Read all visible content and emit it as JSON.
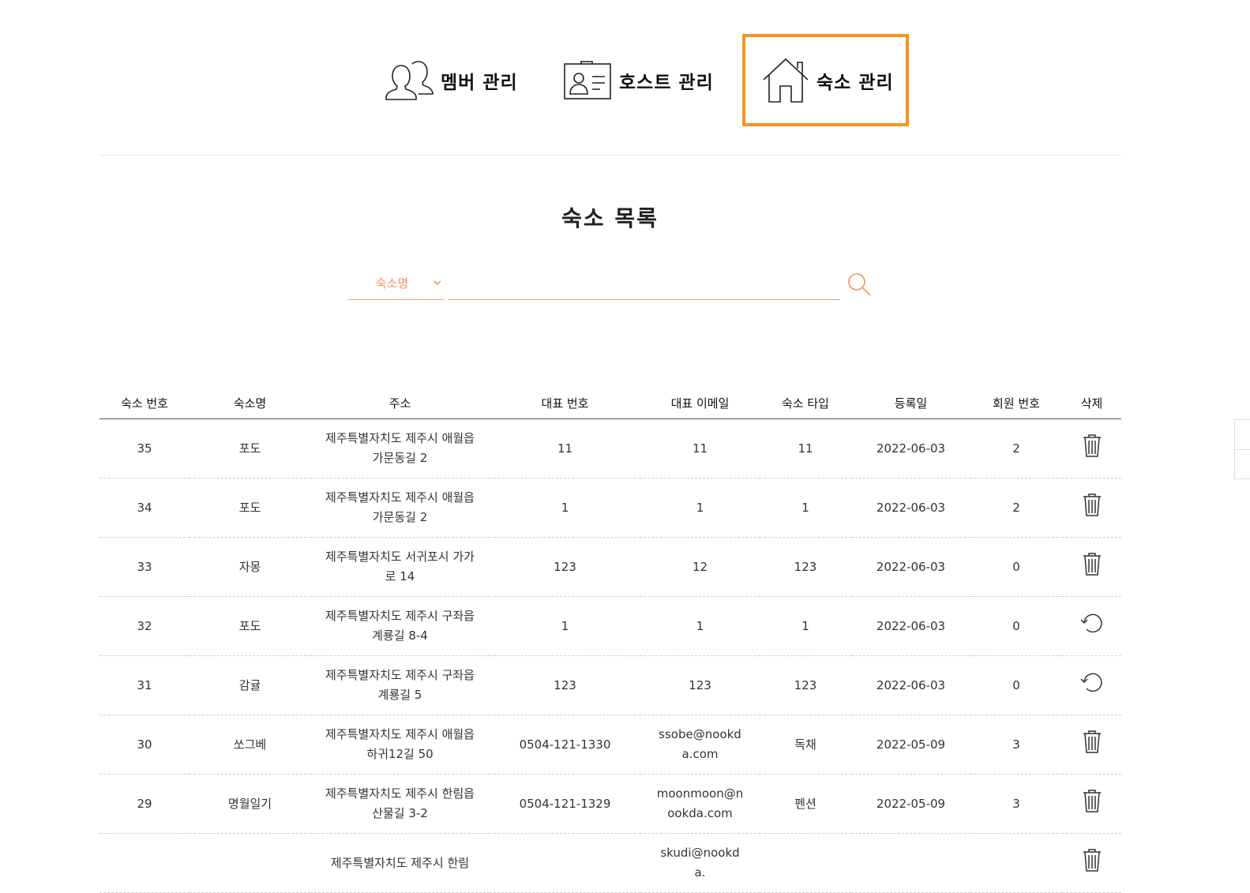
{
  "tabs": [
    {
      "label": "멤버 관리",
      "icon": "users-icon",
      "active": false
    },
    {
      "label": "호스트 관리",
      "icon": "id-card-icon",
      "active": false
    },
    {
      "label": "숙소 관리",
      "icon": "house-icon",
      "active": true
    }
  ],
  "accent_color": "#f7931e",
  "page_title": "숙소 목록",
  "search": {
    "select_value": "숙소명",
    "input_value": "",
    "button_icon": "search-icon"
  },
  "table": {
    "headers": [
      "숙소 번호",
      "숙소명",
      "주소",
      "대표 번호",
      "대표 이메일",
      "숙소 타입",
      "등록일",
      "회원 번호",
      "삭제"
    ],
    "rows": [
      {
        "no": "35",
        "name": "포도",
        "address": "제주특별자치도 제주시 애월읍 가문동길 2",
        "phone": "11",
        "email": "11",
        "type": "11",
        "date": "2022-06-03",
        "member": "2",
        "action": "trash-icon"
      },
      {
        "no": "34",
        "name": "포도",
        "address": "제주특별자치도 제주시 애월읍 가문동길 2",
        "phone": "1",
        "email": "1",
        "type": "1",
        "date": "2022-06-03",
        "member": "2",
        "action": "trash-icon"
      },
      {
        "no": "33",
        "name": "자몽",
        "address": "제주특별자치도 서귀포시 가가로 14",
        "phone": "123",
        "email": "12",
        "type": "123",
        "date": "2022-06-03",
        "member": "0",
        "action": "trash-icon"
      },
      {
        "no": "32",
        "name": "포도",
        "address": "제주특별자치도 제주시 구좌읍 계룡길 8-4",
        "phone": "1",
        "email": "1",
        "type": "1",
        "date": "2022-06-03",
        "member": "0",
        "action": "restore-icon"
      },
      {
        "no": "31",
        "name": "감귤",
        "address": "제주특별자치도 제주시 구좌읍 계룡길 5",
        "phone": "123",
        "email": "123",
        "type": "123",
        "date": "2022-06-03",
        "member": "0",
        "action": "restore-icon"
      },
      {
        "no": "30",
        "name": "쏘그베",
        "address": "제주특별자치도 제주시 애월읍 하귀12길 50",
        "phone": "0504-121-1330",
        "email": "ssobe@nookda.com",
        "type": "독채",
        "date": "2022-05-09",
        "member": "3",
        "action": "trash-icon"
      },
      {
        "no": "29",
        "name": "명월일기",
        "address": "제주특별자치도 제주시 한림읍 산물길 3-2",
        "phone": "0504-121-1329",
        "email": "moonmoon@nookda.com",
        "type": "펜션",
        "date": "2022-05-09",
        "member": "3",
        "action": "trash-icon"
      },
      {
        "no": "",
        "name": "",
        "address": "제주특별자치도 제주시 한림",
        "phone": "",
        "email": "skudi@nookda.",
        "type": "",
        "date": "",
        "member": "",
        "action": "trash-icon"
      }
    ]
  }
}
